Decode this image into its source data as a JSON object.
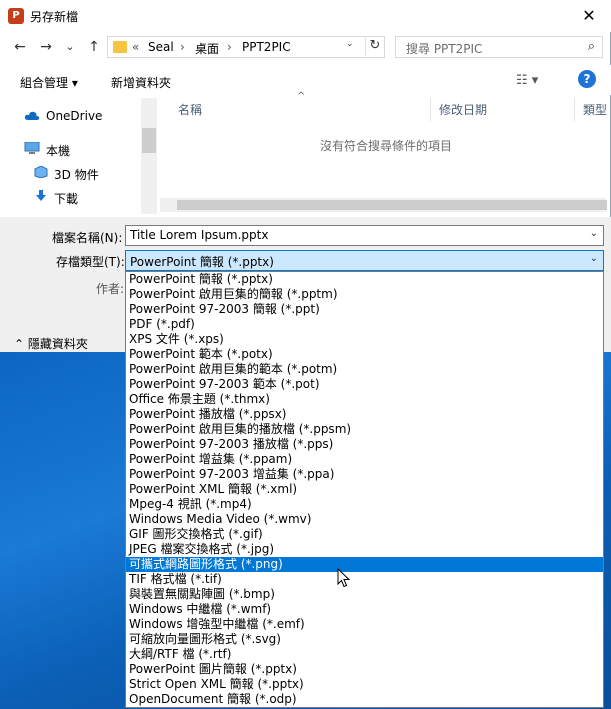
{
  "window": {
    "title": "另存新檔",
    "app_icon": "P",
    "close": "✕"
  },
  "nav": {
    "back": "←",
    "forward": "→",
    "dropdown": "⌄",
    "up": "↑",
    "breadcrumbs": [
      "«",
      "Seal",
      "›",
      "桌面",
      "›",
      "PPT2PIC"
    ],
    "refresh": "↻",
    "search_placeholder": "搜尋 PPT2PIC",
    "search_icon": "⌕"
  },
  "toolbar": {
    "organize": "組合管理 ▾",
    "new_folder": "新增資料夾",
    "view_icon": "☷ ▾",
    "help": "?"
  },
  "sidebar": {
    "items": [
      {
        "label": "OneDrive",
        "icon": "cloud-icon"
      },
      {
        "label": "本機",
        "icon": "computer-icon"
      },
      {
        "label": "3D 物件",
        "icon": "cube-icon"
      },
      {
        "label": "下載",
        "icon": "download-icon"
      }
    ]
  },
  "filelist": {
    "columns": [
      "名稱",
      "修改日期",
      "類型"
    ],
    "sort_indicator": "^",
    "empty_message": "沒有符合搜尋條件的項目"
  },
  "form": {
    "filename_label": "檔案名稱(N):",
    "filename_value": "Title Lorem Ipsum.pptx",
    "filetype_label": "存檔類型(T):",
    "filetype_value": "PowerPoint 簡報 (*.pptx)",
    "author_label": "作者:",
    "hide_folders": "隱藏資料夾",
    "dropdown_arrow": "⌄"
  },
  "filetypes": {
    "selected_index": 19,
    "options": [
      "PowerPoint 簡報 (*.pptx)",
      "PowerPoint 啟用巨集的簡報 (*.pptm)",
      "PowerPoint 97-2003 簡報 (*.ppt)",
      "PDF (*.pdf)",
      "XPS 文件 (*.xps)",
      "PowerPoint 範本 (*.potx)",
      "PowerPoint 啟用巨集的範本 (*.potm)",
      "PowerPoint 97-2003 範本 (*.pot)",
      "Office 佈景主題 (*.thmx)",
      "PowerPoint 播放檔 (*.ppsx)",
      "PowerPoint 啟用巨集的播放檔 (*.ppsm)",
      "PowerPoint 97-2003 播放檔 (*.pps)",
      "PowerPoint 增益集 (*.ppam)",
      "PowerPoint 97-2003 增益集 (*.ppa)",
      "PowerPoint XML 簡報 (*.xml)",
      "Mpeg-4 視訊 (*.mp4)",
      "Windows Media Video (*.wmv)",
      "GIF 圖形交換格式 (*.gif)",
      "JPEG 檔案交換格式 (*.jpg)",
      "可攜式網路圖形格式 (*.png)",
      "TIF 格式檔 (*.tif)",
      "與裝置無關點陣圖 (*.bmp)",
      "Windows 中繼檔 (*.wmf)",
      "Windows 增強型中繼檔 (*.emf)",
      "可縮放向量圖形格式 (*.svg)",
      "大綱/RTF 檔 (*.rtf)",
      "PowerPoint 圖片簡報 (*.pptx)",
      "Strict Open XML 簡報 (*.pptx)",
      "OpenDocument 簡報 (*.odp)"
    ]
  },
  "colors": {
    "accent": "#0078d7",
    "help": "#1f72d6",
    "app": "#c43e1c",
    "folder": "#f5c542"
  }
}
